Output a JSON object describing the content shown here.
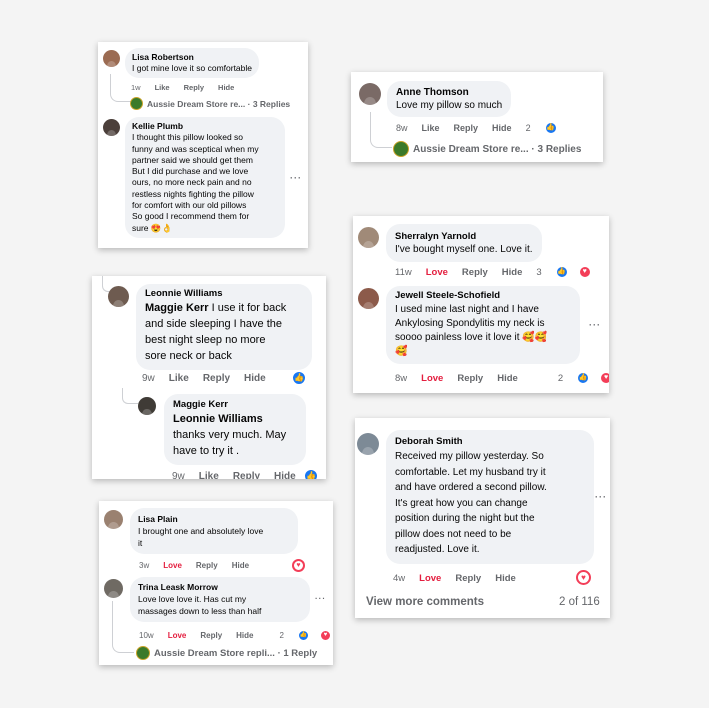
{
  "cards": {
    "c1": {
      "lisa": {
        "name": "Lisa Robertson",
        "text": "I got mine love it so comfortable",
        "time": "1w",
        "like": "Like",
        "reply": "Reply",
        "hide": "Hide"
      },
      "store": {
        "text": "Aussie Dream Store re...",
        "replies": "· 3 Replies"
      },
      "kellie": {
        "name": "Kellie Plumb",
        "lines": [
          "I thought this pillow looked so",
          "funny and was sceptical when my",
          "partner said we should get them",
          "But I did purchase and we love",
          "ours, no more neck pain and no",
          "restless nights fighting the pillow",
          "for comfort with our old pillows",
          "So good I recommend them for",
          "sure 😍👌"
        ]
      },
      "more": "···"
    },
    "c2": {
      "anne": {
        "name": "Anne Thomson",
        "text": "Love my pillow so much",
        "time": "8w",
        "like": "Like",
        "reply": "Reply",
        "hide": "Hide",
        "count": "2"
      },
      "store": {
        "text": "Aussie Dream Store re...",
        "replies": "· 3 Replies"
      }
    },
    "c3": {
      "leonnie": {
        "name": "Leonnie Williams",
        "mention": "Maggie Kerr",
        "lines": [
          "I use it for back",
          "and side sleeping I have the",
          "best night sleep no more",
          "sore neck or back"
        ],
        "time": "9w",
        "like": "Like",
        "reply": "Reply",
        "hide": "Hide"
      },
      "maggie": {
        "name": "Maggie Kerr",
        "mention": "Leonnie Williams",
        "lines": [
          "thanks very much. May",
          "have to try it ."
        ],
        "time": "9w",
        "like": "Like",
        "reply": "Reply",
        "hide": "Hide"
      }
    },
    "c4": {
      "sherralyn": {
        "name": "Sherralyn Yarnold",
        "text": "I've bought myself one. Love it.",
        "time": "11w",
        "love": "Love",
        "reply": "Reply",
        "hide": "Hide",
        "count": "3"
      },
      "jewell": {
        "name": "Jewell Steele-Schofield",
        "lines": [
          "I used mine last night and I have",
          "Ankylosing Spondylitis my neck is",
          "soooo painless love it love it 🥰🥰",
          "🥰"
        ],
        "time": "8w",
        "love": "Love",
        "reply": "Reply",
        "hide": "Hide",
        "count": "2"
      },
      "more": "···"
    },
    "c5": {
      "deborah": {
        "name": "Deborah Smith",
        "lines": [
          "Received my pillow yesterday. So",
          "comfortable. Let my husband try it",
          "and have ordered a second pillow.",
          "It's great how you can change",
          "position during the night but the",
          "pillow does not need to be",
          "readjusted. Love it."
        ],
        "time": "4w",
        "love": "Love",
        "reply": "Reply",
        "hide": "Hide"
      },
      "view_more": "View more comments",
      "count": "2 of 116",
      "more": "···"
    },
    "c6": {
      "lisap": {
        "name": "Lisa Plain",
        "lines": [
          "I brought one and absolutely love",
          "it"
        ],
        "time": "3w",
        "love": "Love",
        "reply": "Reply",
        "hide": "Hide"
      },
      "trina": {
        "name": "Trina Leask Morrow",
        "lines": [
          "Love love love it. Has cut my",
          "massages down to less than half"
        ],
        "time": "10w",
        "love": "Love",
        "reply": "Reply",
        "hide": "Hide",
        "count": "2"
      },
      "store": {
        "text": "Aussie Dream Store repli...",
        "replies": "· 1 Reply"
      },
      "more": "···"
    }
  },
  "icons": {
    "like": "like-icon",
    "heart": "heart-icon"
  },
  "colors": {
    "like": "#1877f2",
    "love": "#e41e3f",
    "bubble": "#f0f2f5",
    "meta": "#65676b"
  }
}
